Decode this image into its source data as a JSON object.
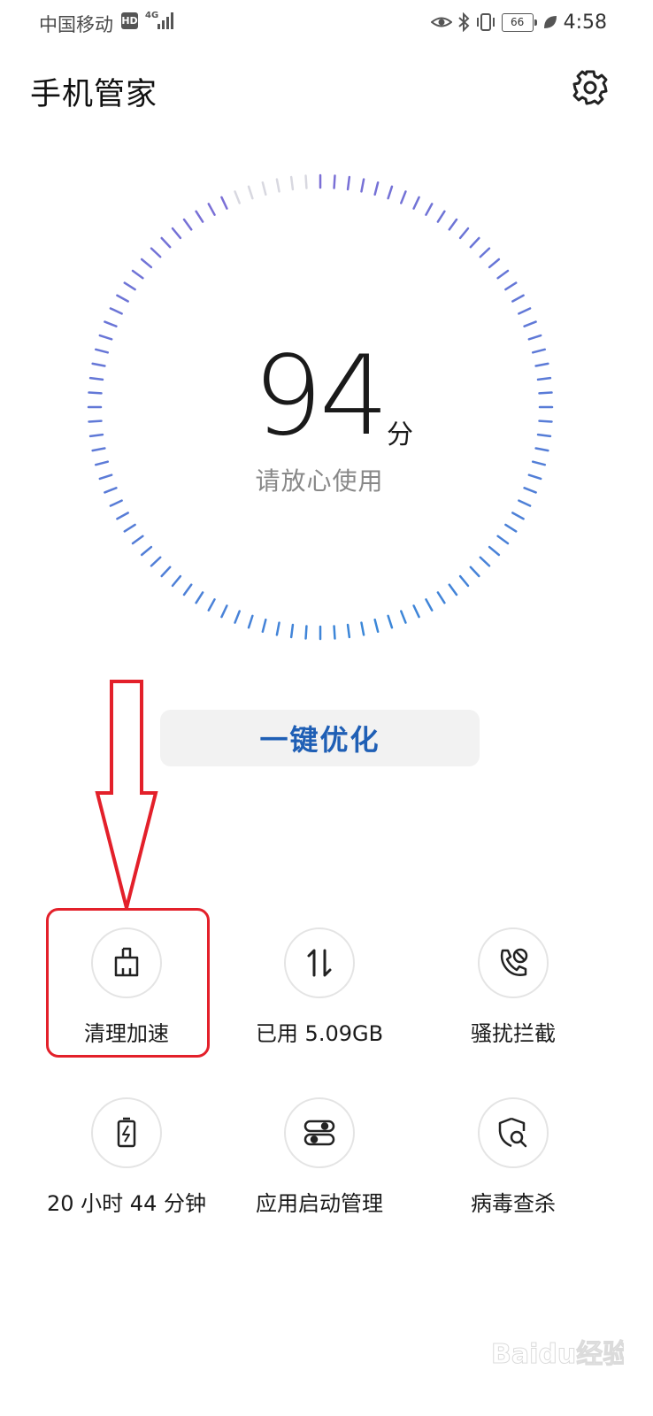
{
  "status_bar": {
    "carrier": "中国移动",
    "hd": "HD",
    "network": "4G",
    "battery": "66",
    "time": "4:58"
  },
  "header": {
    "title": "手机管家",
    "settings_icon": "gear-icon"
  },
  "score": {
    "value": "94",
    "unit": "分",
    "status": "请放心使用"
  },
  "optimize_button": "一键优化",
  "tools": [
    {
      "label": "清理加速",
      "icon": "broom-icon"
    },
    {
      "label": "已用 5.09GB",
      "icon": "data-transfer-icon"
    },
    {
      "label": "骚扰拦截",
      "icon": "phone-block-icon"
    },
    {
      "label": "20 小时 44 分钟",
      "icon": "battery-icon"
    },
    {
      "label": "应用启动管理",
      "icon": "app-launch-icon"
    },
    {
      "label": "病毒查杀",
      "icon": "shield-search-icon"
    }
  ],
  "annotation": {
    "arrow_color": "#e3202a"
  },
  "colors": {
    "accent": "#1f5fb5",
    "gauge_start": "#3a87d8",
    "gauge_end": "#7b6fd6",
    "gauge_inactive": "#d8d8e0"
  },
  "watermark": "Baidu经验"
}
